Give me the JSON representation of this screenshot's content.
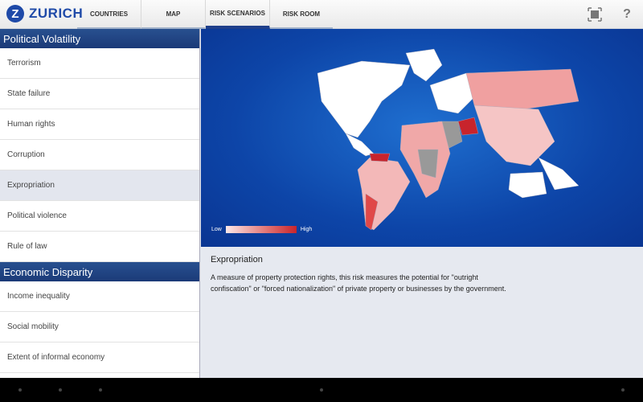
{
  "app": {
    "logo": "Z",
    "brand": "ZURICH"
  },
  "tabs": [
    {
      "label": "COUNTRIES"
    },
    {
      "label": "MAP"
    },
    {
      "label": "RISK SCENARIOS",
      "active": true
    },
    {
      "label": "RISK ROOM"
    }
  ],
  "toolbar": {
    "fullscreen_icon": "fullscreen-icon",
    "help": "?"
  },
  "sidebar": {
    "sections": [
      {
        "title": "Political Volatility",
        "items": [
          "Terrorism",
          "State failure",
          "Human rights",
          "Corruption",
          "Expropriation",
          "Political violence",
          "Rule of law"
        ]
      },
      {
        "title": "Economic Disparity",
        "items": [
          "Income inequality",
          "Social mobility",
          "Extent of informal economy"
        ]
      }
    ],
    "selected": "Expropriation"
  },
  "legend": {
    "low": "Low",
    "high": "High",
    "low_color": "#fde8e8",
    "high_color": "#c8242c"
  },
  "detail": {
    "title": "Expropriation",
    "text": "A measure of property protection rights, this risk measures the potential for \"outright confiscation\" or \"forced nationalization\" of private property or businesses by the government."
  }
}
